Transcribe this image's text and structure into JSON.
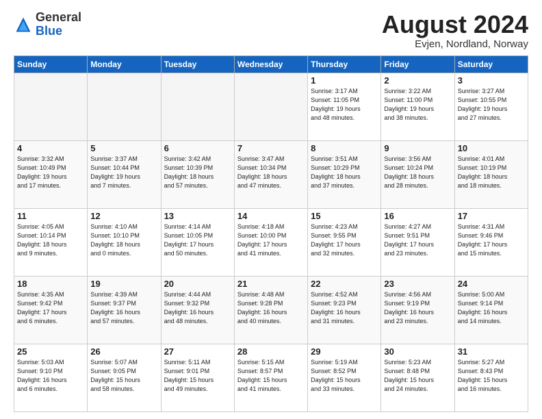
{
  "header": {
    "logo_general": "General",
    "logo_blue": "Blue",
    "month": "August 2024",
    "location": "Evjen, Nordland, Norway"
  },
  "weekdays": [
    "Sunday",
    "Monday",
    "Tuesday",
    "Wednesday",
    "Thursday",
    "Friday",
    "Saturday"
  ],
  "weeks": [
    [
      {
        "day": "",
        "info": ""
      },
      {
        "day": "",
        "info": ""
      },
      {
        "day": "",
        "info": ""
      },
      {
        "day": "",
        "info": ""
      },
      {
        "day": "1",
        "info": "Sunrise: 3:17 AM\nSunset: 11:05 PM\nDaylight: 19 hours\nand 48 minutes."
      },
      {
        "day": "2",
        "info": "Sunrise: 3:22 AM\nSunset: 11:00 PM\nDaylight: 19 hours\nand 38 minutes."
      },
      {
        "day": "3",
        "info": "Sunrise: 3:27 AM\nSunset: 10:55 PM\nDaylight: 19 hours\nand 27 minutes."
      }
    ],
    [
      {
        "day": "4",
        "info": "Sunrise: 3:32 AM\nSunset: 10:49 PM\nDaylight: 19 hours\nand 17 minutes."
      },
      {
        "day": "5",
        "info": "Sunrise: 3:37 AM\nSunset: 10:44 PM\nDaylight: 19 hours\nand 7 minutes."
      },
      {
        "day": "6",
        "info": "Sunrise: 3:42 AM\nSunset: 10:39 PM\nDaylight: 18 hours\nand 57 minutes."
      },
      {
        "day": "7",
        "info": "Sunrise: 3:47 AM\nSunset: 10:34 PM\nDaylight: 18 hours\nand 47 minutes."
      },
      {
        "day": "8",
        "info": "Sunrise: 3:51 AM\nSunset: 10:29 PM\nDaylight: 18 hours\nand 37 minutes."
      },
      {
        "day": "9",
        "info": "Sunrise: 3:56 AM\nSunset: 10:24 PM\nDaylight: 18 hours\nand 28 minutes."
      },
      {
        "day": "10",
        "info": "Sunrise: 4:01 AM\nSunset: 10:19 PM\nDaylight: 18 hours\nand 18 minutes."
      }
    ],
    [
      {
        "day": "11",
        "info": "Sunrise: 4:05 AM\nSunset: 10:14 PM\nDaylight: 18 hours\nand 9 minutes."
      },
      {
        "day": "12",
        "info": "Sunrise: 4:10 AM\nSunset: 10:10 PM\nDaylight: 18 hours\nand 0 minutes."
      },
      {
        "day": "13",
        "info": "Sunrise: 4:14 AM\nSunset: 10:05 PM\nDaylight: 17 hours\nand 50 minutes."
      },
      {
        "day": "14",
        "info": "Sunrise: 4:18 AM\nSunset: 10:00 PM\nDaylight: 17 hours\nand 41 minutes."
      },
      {
        "day": "15",
        "info": "Sunrise: 4:23 AM\nSunset: 9:55 PM\nDaylight: 17 hours\nand 32 minutes."
      },
      {
        "day": "16",
        "info": "Sunrise: 4:27 AM\nSunset: 9:51 PM\nDaylight: 17 hours\nand 23 minutes."
      },
      {
        "day": "17",
        "info": "Sunrise: 4:31 AM\nSunset: 9:46 PM\nDaylight: 17 hours\nand 15 minutes."
      }
    ],
    [
      {
        "day": "18",
        "info": "Sunrise: 4:35 AM\nSunset: 9:42 PM\nDaylight: 17 hours\nand 6 minutes."
      },
      {
        "day": "19",
        "info": "Sunrise: 4:39 AM\nSunset: 9:37 PM\nDaylight: 16 hours\nand 57 minutes."
      },
      {
        "day": "20",
        "info": "Sunrise: 4:44 AM\nSunset: 9:32 PM\nDaylight: 16 hours\nand 48 minutes."
      },
      {
        "day": "21",
        "info": "Sunrise: 4:48 AM\nSunset: 9:28 PM\nDaylight: 16 hours\nand 40 minutes."
      },
      {
        "day": "22",
        "info": "Sunrise: 4:52 AM\nSunset: 9:23 PM\nDaylight: 16 hours\nand 31 minutes."
      },
      {
        "day": "23",
        "info": "Sunrise: 4:56 AM\nSunset: 9:19 PM\nDaylight: 16 hours\nand 23 minutes."
      },
      {
        "day": "24",
        "info": "Sunrise: 5:00 AM\nSunset: 9:14 PM\nDaylight: 16 hours\nand 14 minutes."
      }
    ],
    [
      {
        "day": "25",
        "info": "Sunrise: 5:03 AM\nSunset: 9:10 PM\nDaylight: 16 hours\nand 6 minutes."
      },
      {
        "day": "26",
        "info": "Sunrise: 5:07 AM\nSunset: 9:05 PM\nDaylight: 15 hours\nand 58 minutes."
      },
      {
        "day": "27",
        "info": "Sunrise: 5:11 AM\nSunset: 9:01 PM\nDaylight: 15 hours\nand 49 minutes."
      },
      {
        "day": "28",
        "info": "Sunrise: 5:15 AM\nSunset: 8:57 PM\nDaylight: 15 hours\nand 41 minutes."
      },
      {
        "day": "29",
        "info": "Sunrise: 5:19 AM\nSunset: 8:52 PM\nDaylight: 15 hours\nand 33 minutes."
      },
      {
        "day": "30",
        "info": "Sunrise: 5:23 AM\nSunset: 8:48 PM\nDaylight: 15 hours\nand 24 minutes."
      },
      {
        "day": "31",
        "info": "Sunrise: 5:27 AM\nSunset: 8:43 PM\nDaylight: 15 hours\nand 16 minutes."
      }
    ]
  ]
}
